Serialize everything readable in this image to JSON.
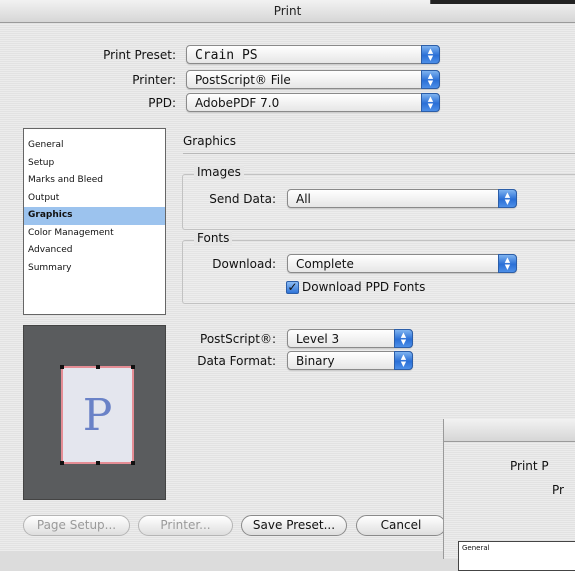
{
  "window": {
    "title": "Print"
  },
  "settings": {
    "preset_label": "Print Preset:",
    "preset_value": "Crain PS",
    "printer_label": "Printer:",
    "printer_value": "PostScript® File",
    "ppd_label": "PPD:",
    "ppd_value": "AdobePDF 7.0"
  },
  "sidebar": {
    "items": [
      {
        "label": "General",
        "selected": false
      },
      {
        "label": "Setup",
        "selected": false
      },
      {
        "label": "Marks and Bleed",
        "selected": false
      },
      {
        "label": "Output",
        "selected": false
      },
      {
        "label": "Graphics",
        "selected": true
      },
      {
        "label": "Color Management",
        "selected": false
      },
      {
        "label": "Advanced",
        "selected": false
      },
      {
        "label": "Summary",
        "selected": false
      }
    ]
  },
  "preview": {
    "letter": "P"
  },
  "graphics": {
    "title": "Graphics",
    "images": {
      "group_title": "Images",
      "send_data_label": "Send Data:",
      "send_data_value": "All"
    },
    "fonts": {
      "group_title": "Fonts",
      "download_label": "Download:",
      "download_value": "Complete",
      "ppd_fonts_label": "Download PPD Fonts",
      "ppd_fonts_checked": true
    },
    "postscript_label": "PostScript®:",
    "postscript_value": "Level 3",
    "data_format_label": "Data Format:",
    "data_format_value": "Binary"
  },
  "buttons": {
    "page_setup": "Page Setup...",
    "printer": "Printer...",
    "save_preset": "Save Preset...",
    "cancel": "Cancel"
  },
  "overlap_dialog": {
    "preset_label_partial": "Print P",
    "printer_label_partial": "Pr",
    "list_first_item": "General"
  },
  "colors": {
    "selection": "#9cc3ee",
    "popup_arrow": "#2a6fd6",
    "preview_bg": "#5a5c5e"
  }
}
